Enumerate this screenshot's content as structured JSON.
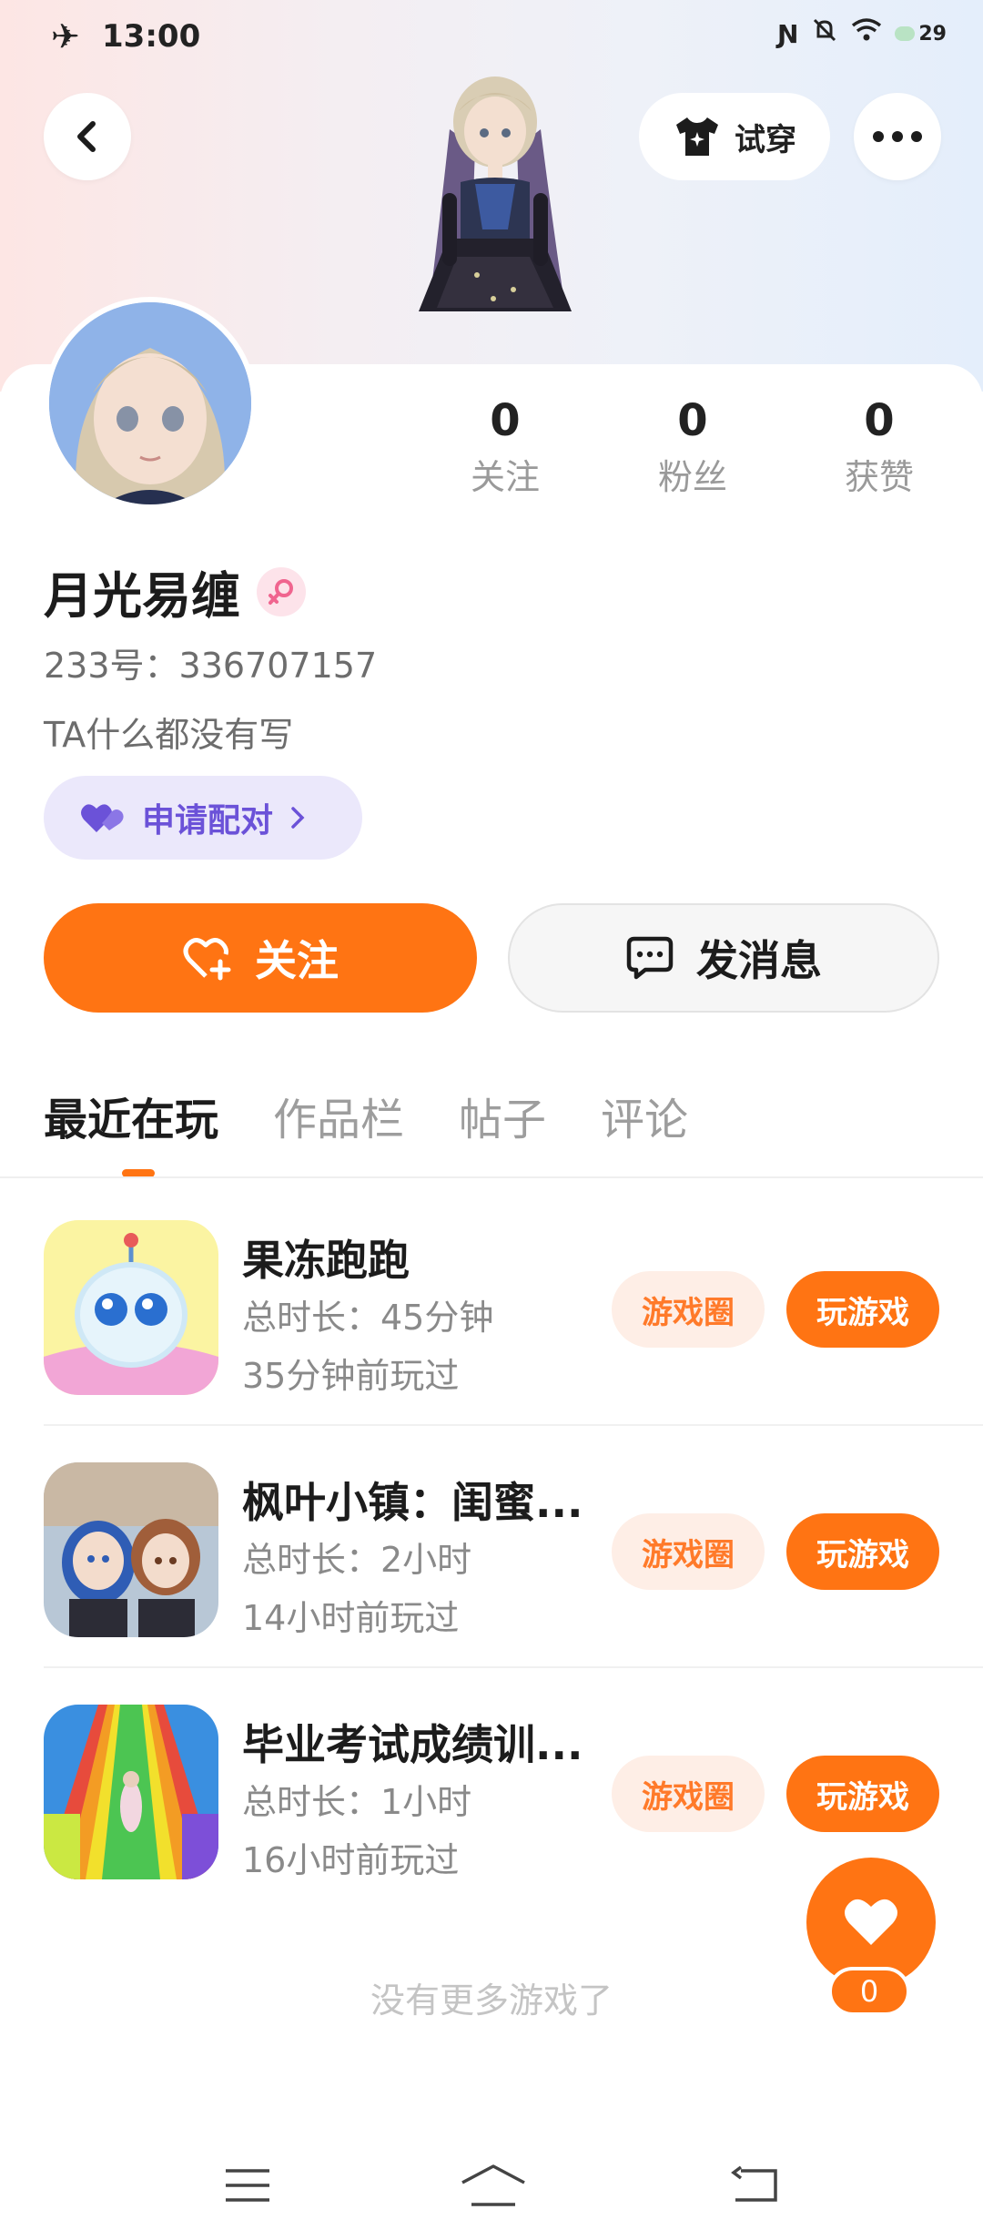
{
  "status_bar": {
    "time": "13:00",
    "battery": "29"
  },
  "header": {
    "tryon_label": "试穿"
  },
  "profile": {
    "name": "月光易缠",
    "uid": "233号：336707157",
    "bio": "TA什么都没有写",
    "pair_label": "申请配对",
    "stats": [
      {
        "value": "0",
        "label": "关注"
      },
      {
        "value": "0",
        "label": "粉丝"
      },
      {
        "value": "0",
        "label": "获赞"
      }
    ]
  },
  "actions": {
    "follow_label": "关注",
    "message_label": "发消息"
  },
  "tabs": [
    "最近在玩",
    "作品栏",
    "帖子",
    "评论"
  ],
  "games": [
    {
      "title": "果冻跑跑",
      "duration": "总时长：45分钟",
      "last_played": "35分钟前玩过",
      "circle_label": "游戏圈",
      "play_label": "玩游戏"
    },
    {
      "title": "枫叶小镇：闺蜜...",
      "duration": "总时长：2小时",
      "last_played": "14小时前玩过",
      "circle_label": "游戏圈",
      "play_label": "玩游戏"
    },
    {
      "title": "毕业考试成绩训...",
      "duration": "总时长：1小时",
      "last_played": "16小时前玩过",
      "circle_label": "游戏圈",
      "play_label": "玩游戏"
    }
  ],
  "footer": {
    "no_more": "没有更多游戏了"
  },
  "like_fab": {
    "count": "0"
  },
  "colors": {
    "accent": "#ff7413",
    "pair_purple": "#6b52d8"
  }
}
